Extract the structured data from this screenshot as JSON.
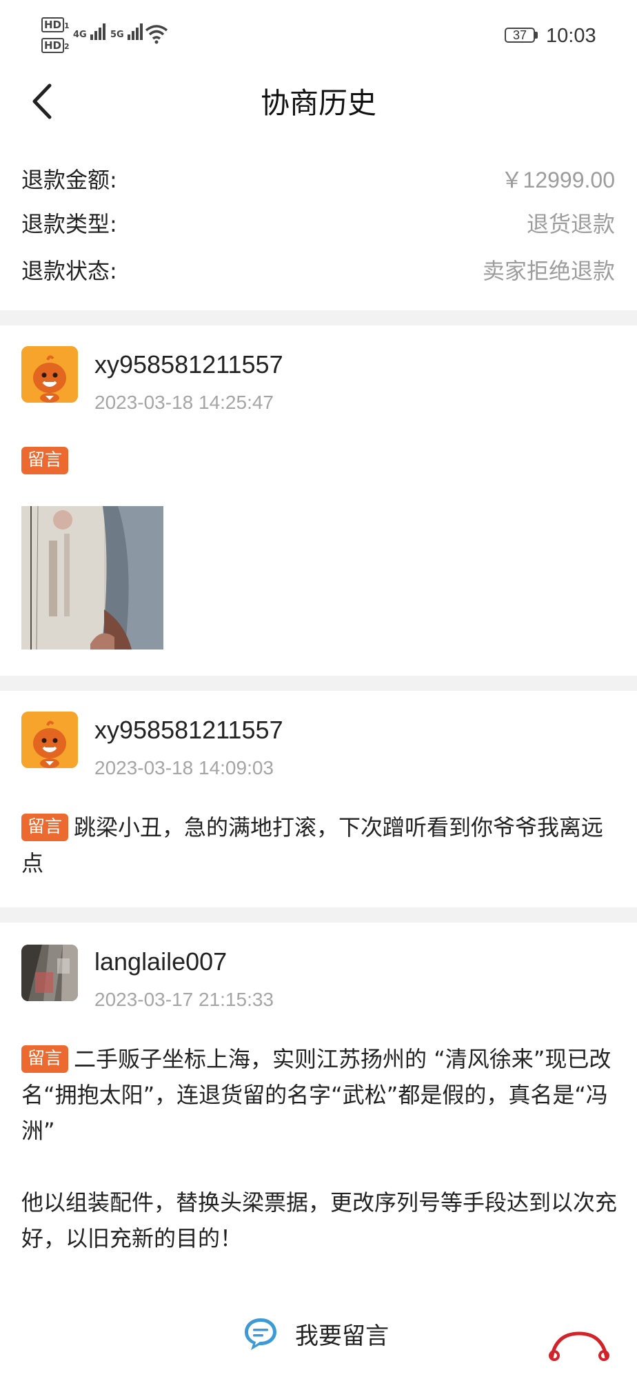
{
  "status_bar": {
    "hd1": "HD",
    "hd1_sub": "1",
    "hd2": "HD",
    "hd2_sub": "2",
    "net1": "4G",
    "net2": "5G",
    "battery": "37",
    "time": "10:03"
  },
  "header": {
    "title": "协商历史"
  },
  "refund": {
    "amount_label": "退款金额:",
    "amount_value": "￥12999.00",
    "type_label": "退款类型:",
    "type_value": "退货退款",
    "status_label": "退款状态:",
    "status_value": "卖家拒绝退款"
  },
  "messages": [
    {
      "user": "xy958581211557",
      "time": "2023-03-18 14:25:47",
      "tag": "留言",
      "text": ""
    },
    {
      "user": "xy958581211557",
      "time": "2023-03-18 14:09:03",
      "tag": "留言",
      "text": "跳梁小丑，急的满地打滚，下次蹭听看到你爷爷我离远点"
    },
    {
      "user": "langlaile007",
      "time": "2023-03-17 21:15:33",
      "tag": "留言",
      "text": "二手贩子坐标上海，实则江苏扬州的 “清风徐来”现已改名“拥抱太阳”，连退货留的名字“武松”都是假的，真名是“冯洲”",
      "text2": "他以组装配件，替换头梁票据，更改序列号等手段达到以次充好，以旧充新的目的！"
    }
  ],
  "footer": {
    "leave_message": "我要留言"
  },
  "colors": {
    "tag_bg": "#ec6a2f",
    "muted": "#9c9c9c",
    "avatar_orange": "#f7a42c",
    "divider": "#f2f2f2"
  },
  "icons": {
    "back": "chevron-left-icon",
    "chat": "chat-bubble-icon",
    "mascot": "mascot-avatar-icon"
  }
}
